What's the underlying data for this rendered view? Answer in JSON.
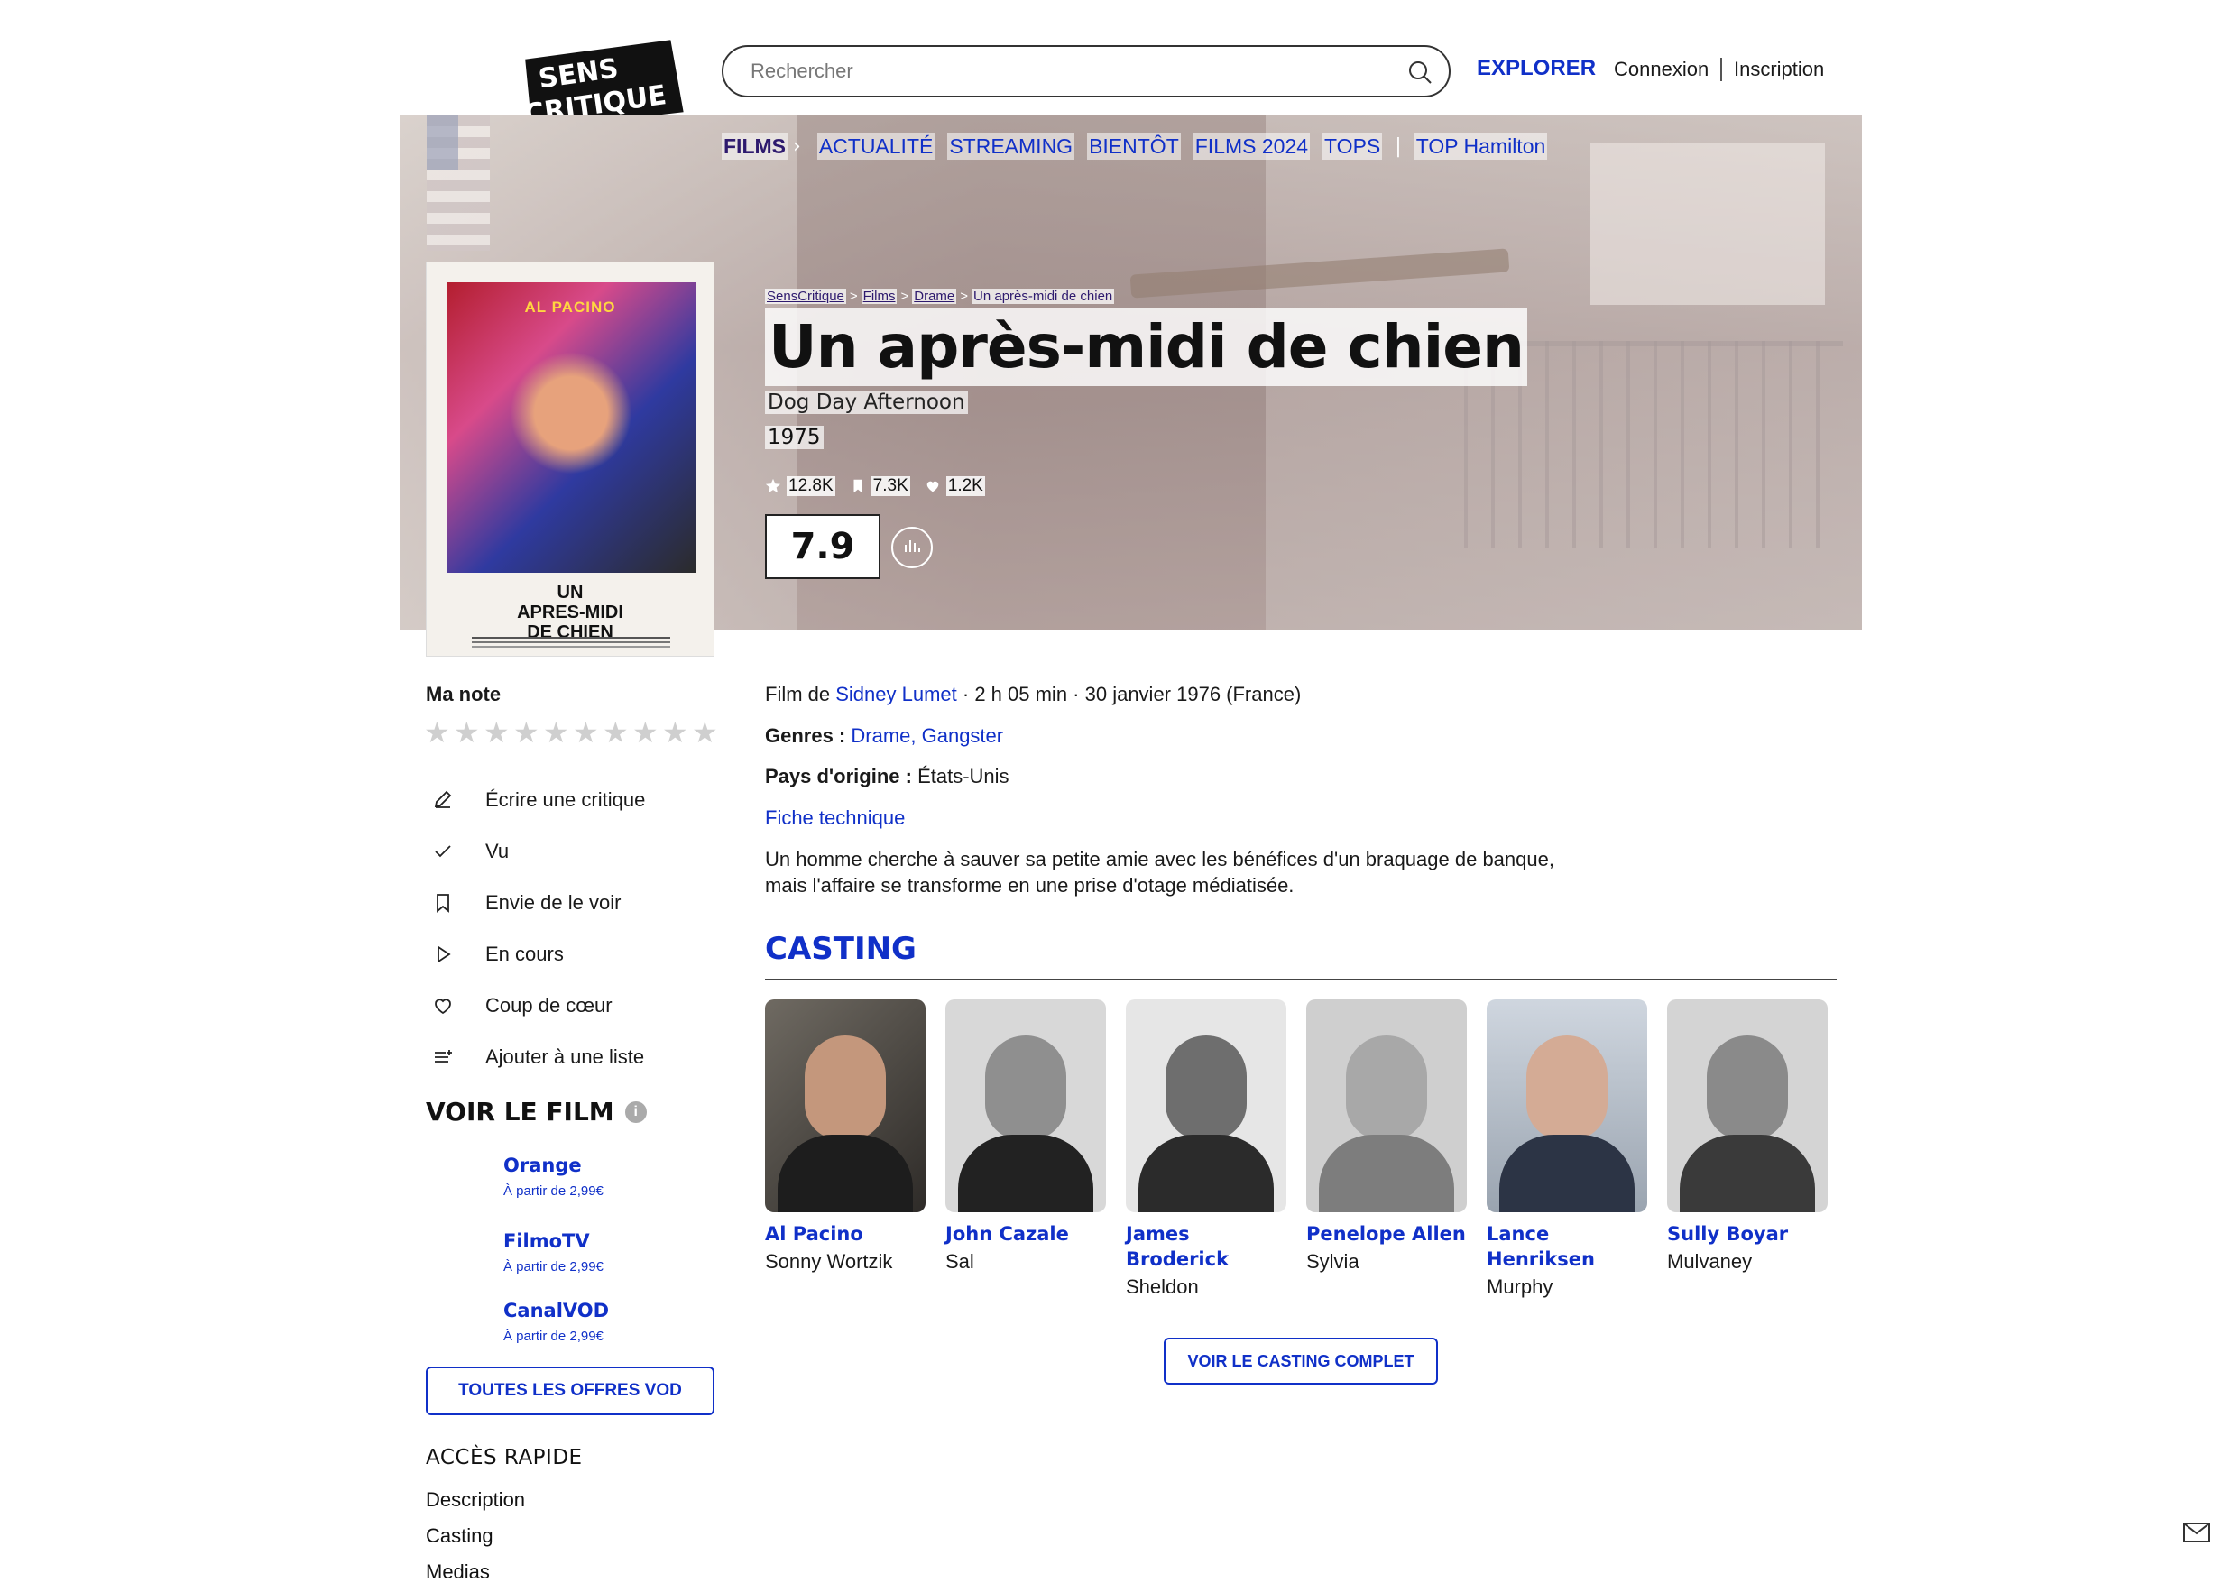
{
  "header": {
    "logo_text": "SENS CRITIQUE",
    "search_placeholder": "Rechercher",
    "explore": "EXPLORER",
    "login": "Connexion",
    "signup": "Inscription"
  },
  "nav": {
    "section": "FILMS",
    "items": [
      "ACTUALITÉ",
      "STREAMING",
      "BIENTÔT",
      "FILMS 2024",
      "TOPS"
    ],
    "extra": "TOP Hamilton"
  },
  "breadcrumb": [
    "SensCritique",
    "Films",
    "Drame",
    "Un après-midi de chien"
  ],
  "film": {
    "title": "Un après-midi de chien",
    "original_title": "Dog Day Afternoon",
    "year": "1975",
    "stats": {
      "ratings": "12.8K",
      "wishlist": "7.3K",
      "favorites": "1.2K"
    },
    "score": "7.9",
    "poster": {
      "actor": "AL PACINO",
      "title": "UN\nAPRES-MIDI\nDE CHIEN"
    },
    "director_prefix": "Film de ",
    "director": "Sidney Lumet",
    "details": " · 2 h 05 min · 30 janvier 1976 (France)",
    "genres_label": "Genres : ",
    "genres": "Drame, Gangster",
    "country_label": "Pays d'origine : ",
    "country": "États-Unis",
    "tech_link": "Fiche technique",
    "synopsis": "Un homme cherche à sauver sa petite amie avec les bénéfices d'un braquage de banque, mais l'affaire se transforme en une prise d'otage médiatisée."
  },
  "sidebar": {
    "my_rating": "Ma note",
    "actions": [
      {
        "label": "Écrire une critique",
        "icon": "pencil-icon"
      },
      {
        "label": "Vu",
        "icon": "check-icon"
      },
      {
        "label": "Envie de le voir",
        "icon": "bookmark-icon"
      },
      {
        "label": "En cours",
        "icon": "play-icon"
      },
      {
        "label": "Coup de cœur",
        "icon": "heart-icon"
      },
      {
        "label": "Ajouter à une liste",
        "icon": "list-add-icon"
      }
    ],
    "watch_title": "VOIR LE FILM",
    "offers": [
      {
        "name": "Orange",
        "price": "À partir de 2,99€"
      },
      {
        "name": "FilmoTV",
        "price": "À partir de 2,99€"
      },
      {
        "name": "CanalVOD",
        "price": "À partir de 2,99€"
      }
    ],
    "vod_button": "TOUTES LES OFFRES VOD",
    "quick_title": "ACCÈS RAPIDE",
    "quick_links": [
      "Description",
      "Casting",
      "Medias"
    ]
  },
  "casting": {
    "title": "CASTING",
    "members": [
      {
        "name": "Al Pacino",
        "role": "Sonny Wortzik"
      },
      {
        "name": "John Cazale",
        "role": "Sal"
      },
      {
        "name": "James Broderick",
        "role": "Sheldon"
      },
      {
        "name": "Penelope Allen",
        "role": "Sylvia"
      },
      {
        "name": "Lance Henriksen",
        "role": "Murphy"
      },
      {
        "name": "Sully Boyar",
        "role": "Mulvaney"
      }
    ],
    "full_button": "VOIR LE CASTING COMPLET"
  },
  "colors": {
    "accent": "#1030c8",
    "text": "#1a1a1a"
  }
}
